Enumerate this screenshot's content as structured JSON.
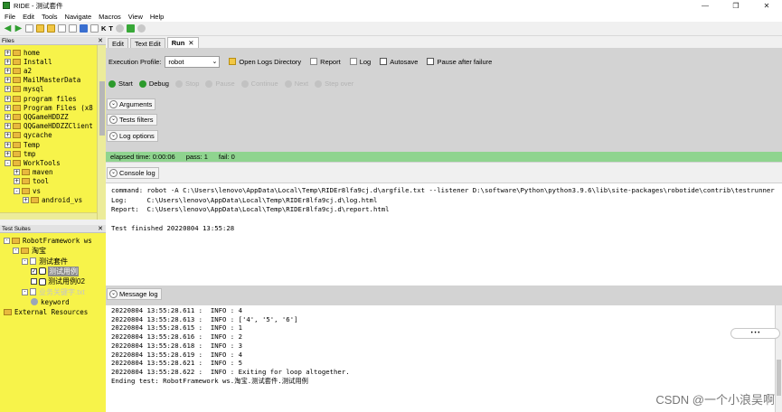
{
  "window": {
    "title": "RIDE - 测试套件",
    "controls": [
      "—",
      "❐",
      "✕"
    ]
  },
  "menu": [
    "File",
    "Edit",
    "Tools",
    "Navigate",
    "Macros",
    "View",
    "Help"
  ],
  "toolbar": {
    "k_label": "K",
    "t_label": "T"
  },
  "files": {
    "header": "Files",
    "items": [
      {
        "label": "home",
        "depth": 0,
        "exp": "+"
      },
      {
        "label": "Install",
        "depth": 0,
        "exp": "+"
      },
      {
        "label": "a2",
        "depth": 0,
        "exp": "+"
      },
      {
        "label": "MailMasterData",
        "depth": 0,
        "exp": "+"
      },
      {
        "label": "mysql",
        "depth": 0,
        "exp": "+"
      },
      {
        "label": "program files",
        "depth": 0,
        "exp": "+"
      },
      {
        "label": "Program Files (x8",
        "depth": 0,
        "exp": "+"
      },
      {
        "label": "QQGameHDDZZ",
        "depth": 0,
        "exp": "+"
      },
      {
        "label": "QQGameHDDZZClient",
        "depth": 0,
        "exp": "+"
      },
      {
        "label": "qycache",
        "depth": 0,
        "exp": "+"
      },
      {
        "label": "Temp",
        "depth": 0,
        "exp": "+"
      },
      {
        "label": "tmp",
        "depth": 0,
        "exp": "+"
      },
      {
        "label": "WorkTools",
        "depth": 0,
        "exp": "-"
      },
      {
        "label": "maven",
        "depth": 1,
        "exp": "+"
      },
      {
        "label": "tool",
        "depth": 1,
        "exp": "+"
      },
      {
        "label": "vs",
        "depth": 1,
        "exp": "-"
      },
      {
        "label": "android_vs",
        "depth": 2,
        "exp": "+"
      }
    ]
  },
  "suites": {
    "header": "Test Suites",
    "items": [
      {
        "label": "RobotFramework ws",
        "depth": 0,
        "type": "folder",
        "exp": "-",
        "mono": true
      },
      {
        "label": "淘宝",
        "depth": 1,
        "type": "folder",
        "exp": "-"
      },
      {
        "label": "测试套件",
        "depth": 2,
        "type": "doc",
        "exp": "-"
      },
      {
        "label": "测试用例",
        "depth": 3,
        "type": "case",
        "checked": true,
        "selected": true
      },
      {
        "label": "测试用例02",
        "depth": 3,
        "type": "case",
        "checked": false
      },
      {
        "label": "业务关键字.txt",
        "depth": 2,
        "type": "doc",
        "exp": "-",
        "dim": true
      },
      {
        "label": "keyword",
        "depth": 3,
        "type": "keyword",
        "mono": true
      },
      {
        "label": "External Resources",
        "depth": 0,
        "type": "folder",
        "mono": true
      }
    ]
  },
  "tabs": [
    {
      "label": "Edit",
      "active": false
    },
    {
      "label": "Text Edit",
      "active": false
    },
    {
      "label": "Run",
      "active": true
    }
  ],
  "run": {
    "profile_label": "Execution Profile:",
    "profile_value": "robot",
    "open_logs": "Open Logs Directory",
    "report": "Report",
    "log": "Log",
    "autosave": "Autosave",
    "pause_failure": "Pause after failure",
    "buttons": [
      {
        "label": "Start",
        "color": "#2c9a2c",
        "enabled": true
      },
      {
        "label": "Debug",
        "color": "#2c9a2c",
        "enabled": true
      },
      {
        "label": "Stop",
        "color": "#c2c2c2",
        "enabled": false
      },
      {
        "label": "Pause",
        "color": "#c2c2c2",
        "enabled": false
      },
      {
        "label": "Continue",
        "color": "#c2c2c2",
        "enabled": false
      },
      {
        "label": "Next",
        "color": "#c2c2c2",
        "enabled": false
      },
      {
        "label": "Step over",
        "color": "#c2c2c2",
        "enabled": false
      }
    ],
    "arguments": "Arguments",
    "tests_filters": "Tests filters",
    "log_options": "Log options",
    "elapsed": "elapsed time: 0:00:06",
    "pass": "pass: 1",
    "fail": "fail: 0",
    "console_log": "Console log",
    "message_log": "Message log"
  },
  "console_lines": [
    "command: robot -A C:\\Users\\lenovo\\AppData\\Local\\Temp\\RIDEr8lfa9cj.d\\argfile.txt --listener D:\\software\\Python\\python3.9.6\\lib\\site-packages\\robotide\\contrib\\testrunner",
    "Log:     C:\\Users\\lenovo\\AppData\\Local\\Temp\\RIDEr8lfa9cj.d\\log.html",
    "Report:  C:\\Users\\lenovo\\AppData\\Local\\Temp\\RIDEr8lfa9cj.d\\report.html",
    "",
    "Test finished 20220804 13:55:28"
  ],
  "message_lines": [
    "20220804 13:55:28.611 :  INFO : 4",
    "20220804 13:55:28.613 :  INFO : ['4', '5', '6']",
    "20220804 13:55:28.615 :  INFO : 1",
    "20220804 13:55:28.616 :  INFO : 2",
    "20220804 13:55:28.618 :  INFO : 3",
    "20220804 13:55:28.619 :  INFO : 4",
    "20220804 13:55:28.621 :  INFO : 5",
    "20220804 13:55:28.622 :  INFO : Exiting for loop altogether.",
    "Ending test: RobotFramework ws.淘宝.测试套件.测试用例"
  ],
  "watermark": "CSDN @一个小浪吴啊"
}
